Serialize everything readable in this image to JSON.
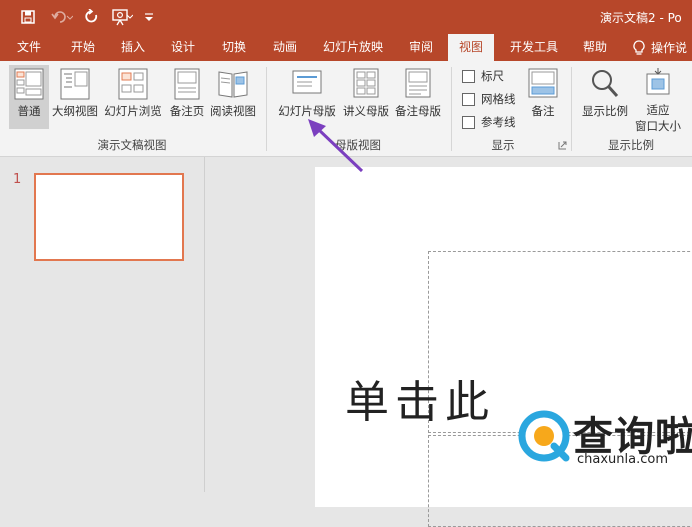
{
  "quick_access": {
    "save_icon": "save-icon",
    "undo_icon": "undo-icon",
    "redo_icon": "redo-icon",
    "present_icon": "present-from-start-icon",
    "customize_icon": "customize-qat-icon"
  },
  "window": {
    "title": "演示文稿2  -  Po"
  },
  "tabs": [
    {
      "label": "文件"
    },
    {
      "label": "开始"
    },
    {
      "label": "插入"
    },
    {
      "label": "设计"
    },
    {
      "label": "切换"
    },
    {
      "label": "动画"
    },
    {
      "label": "幻灯片放映"
    },
    {
      "label": "审阅"
    },
    {
      "label": "视图",
      "active": true
    },
    {
      "label": "开发工具"
    },
    {
      "label": "帮助"
    }
  ],
  "tell_me": {
    "label": "操作说"
  },
  "ribbon": {
    "presentation_views": {
      "group_label": "演示文稿视图",
      "normal": "普通",
      "outline": "大纲视图",
      "sorter": "幻灯片浏览",
      "notes_page": "备注页",
      "reading": "阅读视图"
    },
    "master_views": {
      "group_label": "母版视图",
      "slide_master": "幻灯片母版",
      "handout_master": "讲义母版",
      "notes_master": "备注母版"
    },
    "show": {
      "group_label": "显示",
      "ruler": "标尺",
      "gridlines": "网格线",
      "guides": "参考线",
      "notes": "备注"
    },
    "zoom": {
      "group_label": "显示比例",
      "zoom": "显示比例",
      "fit_line1": "适应",
      "fit_line2": "窗口大小"
    }
  },
  "slides": {
    "number": "1"
  },
  "slide": {
    "title_text": "单击此"
  },
  "watermark": {
    "cn": "查询啦",
    "en": "chaxunla.com"
  },
  "colors": {
    "accent": "#b7472a",
    "arrow": "#7b3fbf",
    "thumb_border": "#e2774f"
  }
}
